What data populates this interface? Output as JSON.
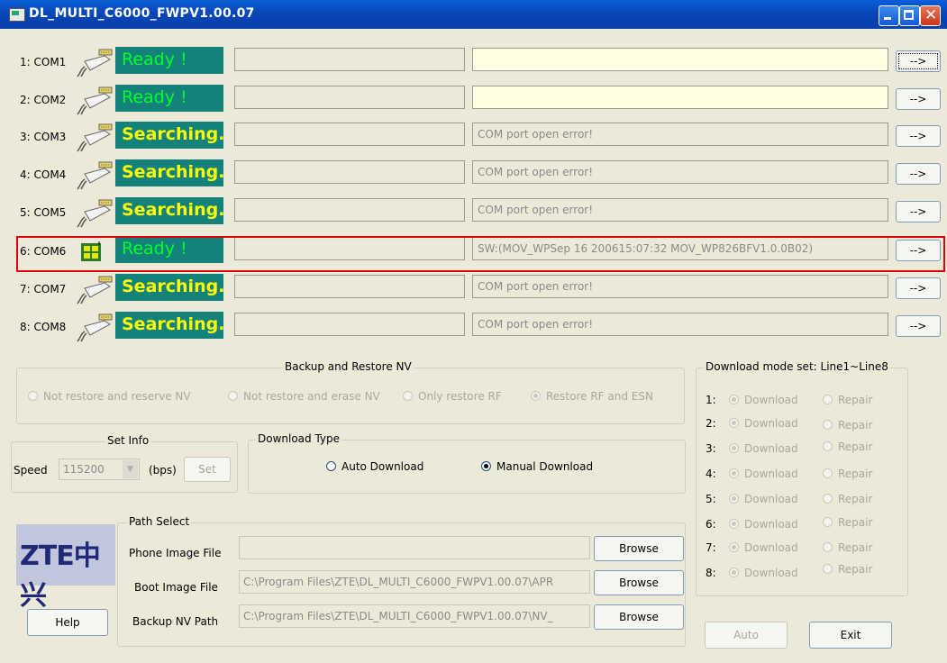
{
  "window": {
    "title": "DL_MULTI_C6000_FWPV1.00.07"
  },
  "ports": [
    {
      "label": "1: COM1",
      "status": "Ready !",
      "status_kind": "ready",
      "info": "",
      "info_bg": "yellow",
      "go": "-->",
      "icon": "plug-icon"
    },
    {
      "label": "2: COM2",
      "status": "Ready !",
      "status_kind": "ready",
      "info": "",
      "info_bg": "yellow",
      "go": "-->",
      "icon": "plug-icon"
    },
    {
      "label": "3: COM3",
      "status": "Searching...",
      "status_kind": "search",
      "info": "COM port open error!",
      "info_bg": "gray",
      "go": "-->",
      "icon": "plug-icon"
    },
    {
      "label": "4: COM4",
      "status": "Searching...",
      "status_kind": "search",
      "info": "COM port open error!",
      "info_bg": "gray",
      "go": "-->",
      "icon": "plug-icon"
    },
    {
      "label": "5: COM5",
      "status": "Searching...",
      "status_kind": "search",
      "info": "COM port open error!",
      "info_bg": "gray",
      "go": "-->",
      "icon": "plug-icon"
    },
    {
      "label": "6: COM6",
      "status": "Ready !",
      "status_kind": "ready",
      "info": "SW:(MOV_WPSep 16 200615:07:32 MOV_WP826BFV1.0.0B02)",
      "info_bg": "gray",
      "go": "-->",
      "icon": "chip-icon"
    },
    {
      "label": "7: COM7",
      "status": "Searching...",
      "status_kind": "search",
      "info": "COM port open error!",
      "info_bg": "gray",
      "go": "-->",
      "icon": "plug-icon"
    },
    {
      "label": "8: COM8",
      "status": "Searching...",
      "status_kind": "search",
      "info": "COM port open error!",
      "info_bg": "gray",
      "go": "-->",
      "icon": "plug-icon"
    }
  ],
  "backup": {
    "title": "Backup and Restore NV",
    "options": [
      "Not restore and reserve NV",
      "Not restore and erase NV",
      "Only restore RF",
      "Restore RF and ESN"
    ],
    "selected": 3
  },
  "setinfo": {
    "title": "Set Info",
    "speed_label": "Speed",
    "speed_value": "115200",
    "unit": "(bps)",
    "set_label": "Set"
  },
  "download_type": {
    "title": "Download Type",
    "auto": "Auto Download",
    "manual": "Manual Download",
    "selected": "manual"
  },
  "mode": {
    "title": "Download mode set: Line1~Line8",
    "lines": [
      "1:",
      "2:",
      "3:",
      "4:",
      "5:",
      "6:",
      "7:",
      "8:"
    ],
    "download": "Download",
    "repair": "Repair"
  },
  "path": {
    "title": "Path Select",
    "phone_label": "Phone Image File",
    "phone_value": "",
    "boot_label": "Boot Image File",
    "boot_value": "C:\\Program Files\\ZTE\\DL_MULTI_C6000_FWPV1.00.07\\APR",
    "backup_label": "Backup NV Path",
    "backup_value": "C:\\Program Files\\ZTE\\DL_MULTI_C6000_FWPV1.00.07\\NV_",
    "browse": "Browse"
  },
  "logo_text": "ZTE中兴",
  "buttons": {
    "help": "Help",
    "auto": "Auto",
    "exit": "Exit"
  },
  "colors": {
    "status_bg": "#13827a",
    "ready": "#00ff2a",
    "searching": "#ffff00",
    "highlight": "#e0000a"
  }
}
